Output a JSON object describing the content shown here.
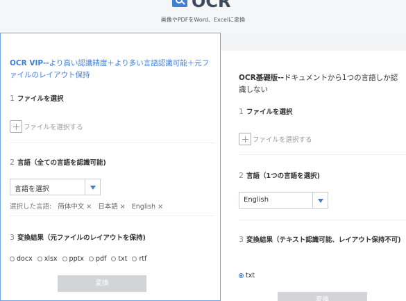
{
  "header": {
    "logo_text": "OCR",
    "subtitle": "画像やPDFをWord、Excelに変換"
  },
  "vip": {
    "intro_bold": "OCR VIP--",
    "intro_text": "より高い認識精度＋より多い言語認識可能＋元ファイルのレイアウト保持",
    "step1": {
      "num": "1",
      "label": "ファイルを選択"
    },
    "file_pick_label": "ファイルを選択する",
    "step2": {
      "num": "2",
      "label": "言語（全ての言語を認識可能)"
    },
    "language_select": "言語を選択",
    "chosen_prefix": "選択した言語:",
    "chosen_tags": [
      "简体中文 ×",
      "日本語 ×",
      "English ×"
    ],
    "step3": {
      "num": "3",
      "label": "変換結果（元ファイルのレイアウトを保持)"
    },
    "formats": [
      "docx",
      "xlsx",
      "pptx",
      "pdf",
      "txt",
      "rtf"
    ],
    "convert_label": "変換"
  },
  "basic": {
    "intro_bold": "OCR基礎版--",
    "intro_text": "ドキュメントから1つの言語しか認識しない",
    "step1": {
      "num": "1",
      "label": "ファイルを選択"
    },
    "file_pick_label": "ファイルを選択する",
    "step2": {
      "num": "2",
      "label": "言語（1つの言語を選択)"
    },
    "language_select": "English",
    "step3": {
      "num": "3",
      "label": "変換結果（テキスト認識可能、レイアウト保持不可)"
    },
    "formats": [
      "txt"
    ],
    "convert_label": "変換"
  },
  "colors": {
    "accent": "#3f7fd3",
    "disabled_button": "#d3d4d6"
  }
}
